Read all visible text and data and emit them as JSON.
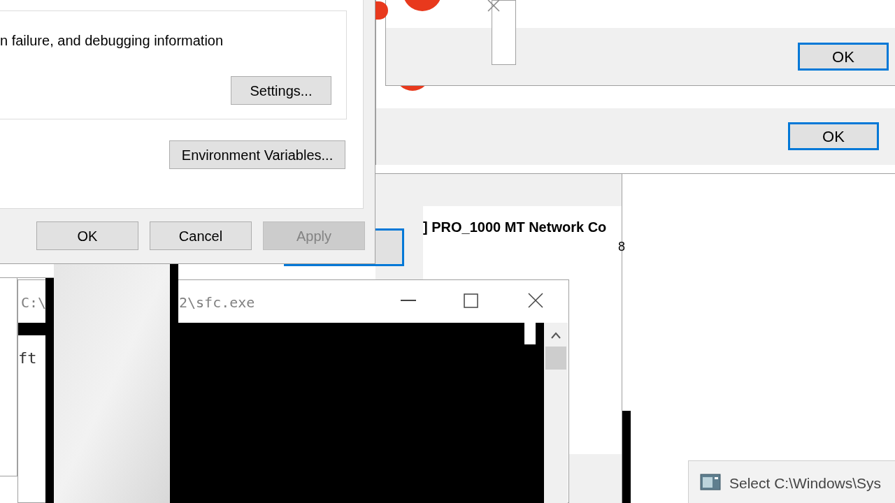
{
  "system_properties": {
    "description": "n failure, and debugging information",
    "settings_button": "Settings...",
    "env_button": "Environment Variables...",
    "buttons": [
      {
        "label": "OK",
        "disabled": false
      },
      {
        "label": "Cancel",
        "disabled": false
      },
      {
        "label": "Apply",
        "disabled": true
      }
    ]
  },
  "error_dialogs": [
    {
      "button": "OK",
      "focused": true
    },
    {
      "button": "OK",
      "focused": true
    }
  ],
  "network_window": {
    "title": "] PRO_1000 MT Network Co",
    "fragment": "8"
  },
  "console_window": {
    "title_parts": [
      "C:\\",
      "2\\sfc.exe"
    ],
    "behind_text": "ft"
  },
  "taskbar_popup": {
    "title": "Select C:\\Windows\\Sys"
  }
}
